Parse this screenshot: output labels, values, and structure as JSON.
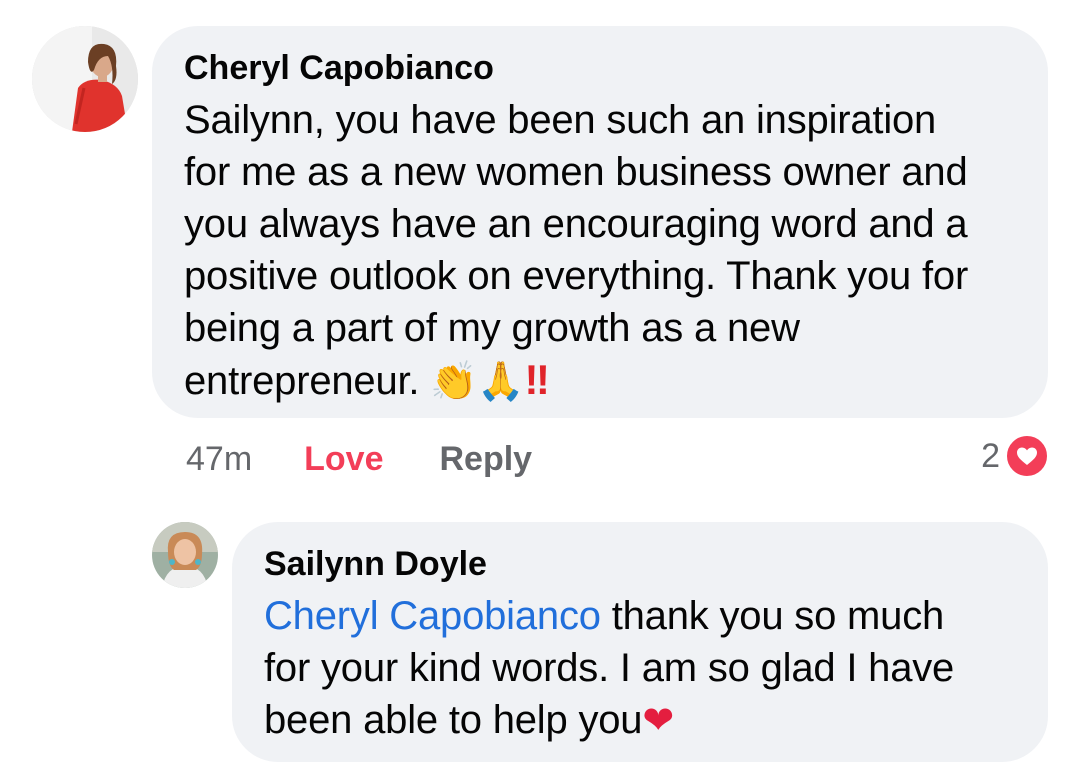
{
  "comment": {
    "author": "Cheryl Capobianco",
    "body_lines": [
      "Sailynn, you have been such an inspiration",
      "for me as a new women business owner and",
      "you always have an encouraging word and a",
      "positive outlook on everything. Thank you for",
      "being a part of my growth as a new",
      "entrepreneur."
    ],
    "emojis": {
      "clap": "👏",
      "pray": "🙏",
      "exclamation": "‼"
    },
    "time": "47m",
    "love_label": "Love",
    "reply_label": "Reply",
    "reaction_count": "2",
    "reaction_type": "love-icon"
  },
  "reply": {
    "author": "Sailynn Doyle",
    "mention": "Cheryl Capobianco",
    "body_lines": [
      " thank you so much",
      "for your kind words. I am so glad I have",
      "been able to help you"
    ],
    "emoji_heart": "❤"
  },
  "colors": {
    "bubble": "#f0f2f5",
    "mention": "#216fdb",
    "love": "#f33e58",
    "muted": "#65676b"
  }
}
